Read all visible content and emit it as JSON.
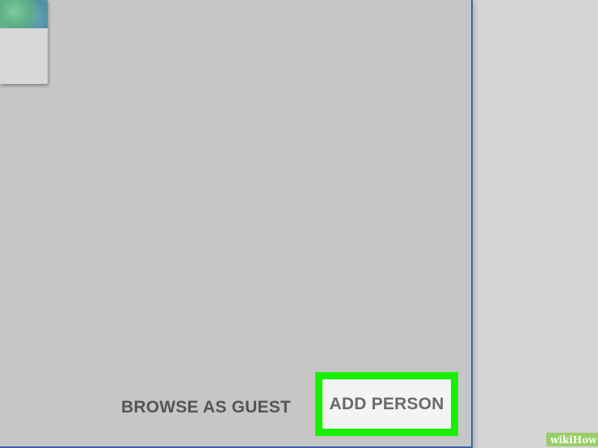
{
  "dialog": {
    "browse_guest_label": "BROWSE AS GUEST",
    "add_person_label": "ADD PERSON"
  },
  "profile": {
    "avatar_icon": "profile-avatar-image"
  },
  "highlight": {
    "color": "#18f000",
    "target": "add-person-button"
  },
  "watermark": {
    "text_wiki": "wiki",
    "text_how": "How"
  },
  "colors": {
    "dialog_bg": "#c6c6c6",
    "outer_bg": "#d6d6d6",
    "border_accent": "#3f5fae"
  }
}
